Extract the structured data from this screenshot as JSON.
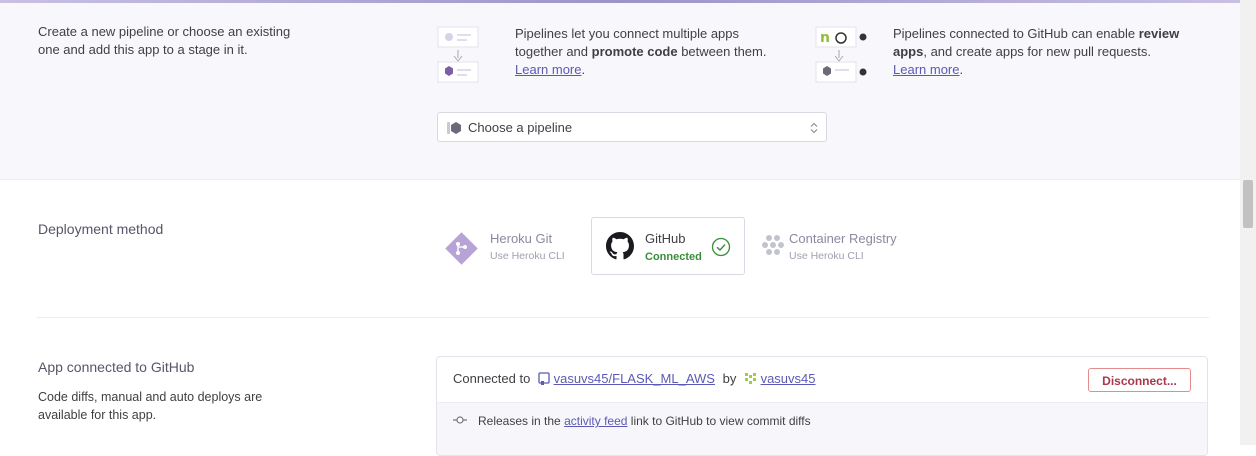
{
  "pipeline": {
    "intro_line1": "Create a new pipeline or choose an existing",
    "intro_line2": "one and add this app to a stage in it.",
    "info1_line1": "Pipelines let you connect multiple apps",
    "info1_line2_pre": "together and ",
    "info1_line2_bold": "promote code",
    "info1_line2_post": " between them.",
    "info1_link": "Learn more",
    "info2_line1_pre": "Pipelines connected to GitHub can enable ",
    "info2_line1_bold": "review",
    "info2_line2_bold": "apps",
    "info2_line2_post": ", and create apps for new pull requests.",
    "info2_link": "Learn more",
    "select_value": "Choose a pipeline"
  },
  "deployment": {
    "title": "Deployment method",
    "options": [
      {
        "name": "Heroku Git",
        "sub": "Use Heroku CLI"
      },
      {
        "name": "GitHub",
        "sub": "Connected"
      },
      {
        "name": "Container Registry",
        "sub": "Use Heroku CLI"
      }
    ]
  },
  "connected": {
    "title": "App connected to GitHub",
    "desc_line1": "Code diffs, manual and auto deploys are",
    "desc_line2": "available for this app.",
    "connected_to": "Connected to",
    "repo": "vasuvs45/FLASK_ML_AWS",
    "by": "by",
    "user": "vasuvs45",
    "disconnect": "Disconnect...",
    "releases_pre": "Releases in the ",
    "releases_link": "activity feed",
    "releases_post": " link to GitHub to view commit diffs"
  },
  "colors": {
    "accent": "#79589f",
    "link": "#5a5ab4",
    "success": "#3a8d3a",
    "danger": "#a9374c"
  }
}
